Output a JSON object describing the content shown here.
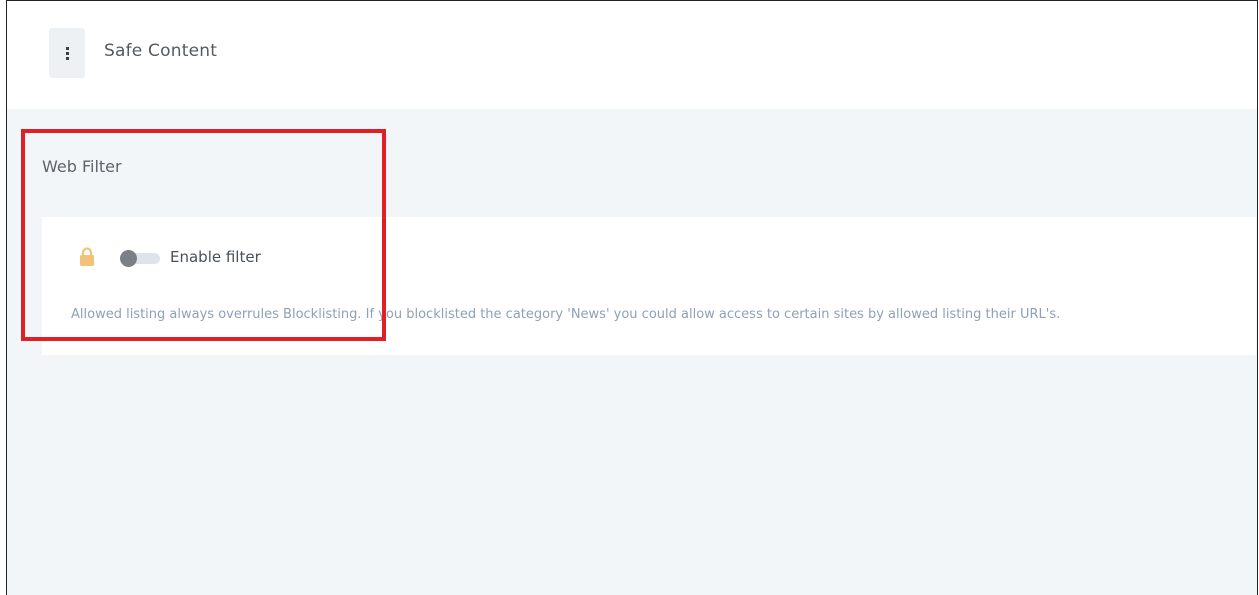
{
  "header": {
    "title": "Safe Content",
    "menu_icon": "more-vertical-icon"
  },
  "section": {
    "title": "Web Filter"
  },
  "filter": {
    "lock_icon": "lock-icon",
    "toggle_label": "Enable filter",
    "enabled": false,
    "info_text": "Allowed listing always overrules Blocklisting. If you blocklisted the category 'News' you could allow access to certain sites by allowed listing their URL's."
  },
  "colors": {
    "accent_lock": "#f2c27a",
    "highlight_border": "#e21f26",
    "content_background": "#f3f6f9",
    "info_text": "#8fa1b6"
  }
}
